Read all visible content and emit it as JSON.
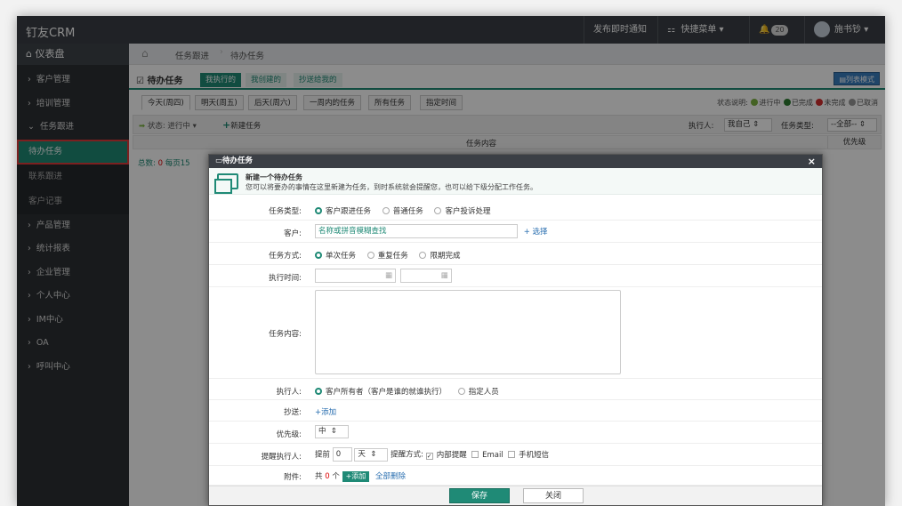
{
  "topbar": {
    "brand": "钉友CRM",
    "notify_label": "发布即时通知",
    "quick_menu_label": "快捷菜单",
    "bell_count": "20",
    "user_name": "施书钞"
  },
  "sidebar": {
    "dashboard_label": "仪表盘",
    "items": [
      {
        "label": "客户管理"
      },
      {
        "label": "培训管理"
      },
      {
        "label": "任务跟进"
      }
    ],
    "sub_items": [
      {
        "label": "待办任务"
      },
      {
        "label": "联系跟进"
      },
      {
        "label": "客户记事"
      }
    ],
    "items2": [
      {
        "label": "产品管理"
      },
      {
        "label": "统计报表"
      },
      {
        "label": "企业管理"
      },
      {
        "label": "个人中心"
      },
      {
        "label": "IM中心"
      },
      {
        "label": "OA"
      },
      {
        "label": "呼叫中心"
      }
    ]
  },
  "breadcrumb": {
    "level1": "任务跟进",
    "level2": "待办任务"
  },
  "page": {
    "title": "待办任务",
    "tabs": [
      "我执行的",
      "我创建的",
      "抄送给我的"
    ],
    "list_mode": "列表模式",
    "day_tabs": [
      "今天(周四)",
      "明天(周五)",
      "后天(周六)",
      "一周内的任务",
      "所有任务",
      "指定时间"
    ],
    "status_note_label": "状态说明:",
    "status_in_progress": "进行中",
    "status_done": "已完成",
    "status_undone": "未完成",
    "status_cancel": "已取消",
    "toolbar_status": "状态: 进行中",
    "new_task": "新建任务",
    "executor_label": "执行人:",
    "executor_value": "我自己",
    "task_type_label": "任务类型:",
    "task_type_value": "--全部--",
    "col_content": "任务内容",
    "col_priority": "优先级",
    "total_prefix": "总数:",
    "total_value": "0",
    "per_page": "每页15"
  },
  "modal": {
    "title": "待办任务",
    "intro_title": "新建一个待办任务",
    "intro_desc": "您可以将要办的事情在这里新建为任务，到时系统就会提醒您，也可以给下级分配工作任务。",
    "type_label": "任务类型:",
    "type_options": [
      "客户跟进任务",
      "普通任务",
      "客户投诉处理"
    ],
    "customer_label": "客户:",
    "customer_value": "名称或拼音模糊查找",
    "customer_choose": "+ 选择",
    "mode_label": "任务方式:",
    "mode_options": [
      "单次任务",
      "重复任务",
      "限期完成"
    ],
    "time_label": "执行时间:",
    "content_label": "任务内容:",
    "executor_label": "执行人:",
    "executor_options": [
      "客户所有者（客户是谁的就谁执行）",
      "指定人员"
    ],
    "cc_label": "抄送:",
    "cc_add": "+添加",
    "priority_label": "优先级:",
    "priority_value": "中",
    "remind_label": "提醒执行人:",
    "remind_before": "提前",
    "remind_num": "0",
    "remind_unit": "天",
    "remind_method": "提醒方式:",
    "remind_opts": [
      "内部提醒",
      "Email",
      "手机短信"
    ],
    "attach_label": "附件:",
    "attach_prefix": "共",
    "attach_count": "0",
    "attach_suffix": "个",
    "attach_add": "+添加",
    "attach_delete_all": "全部删除",
    "save": "保存",
    "close": "关闭"
  }
}
